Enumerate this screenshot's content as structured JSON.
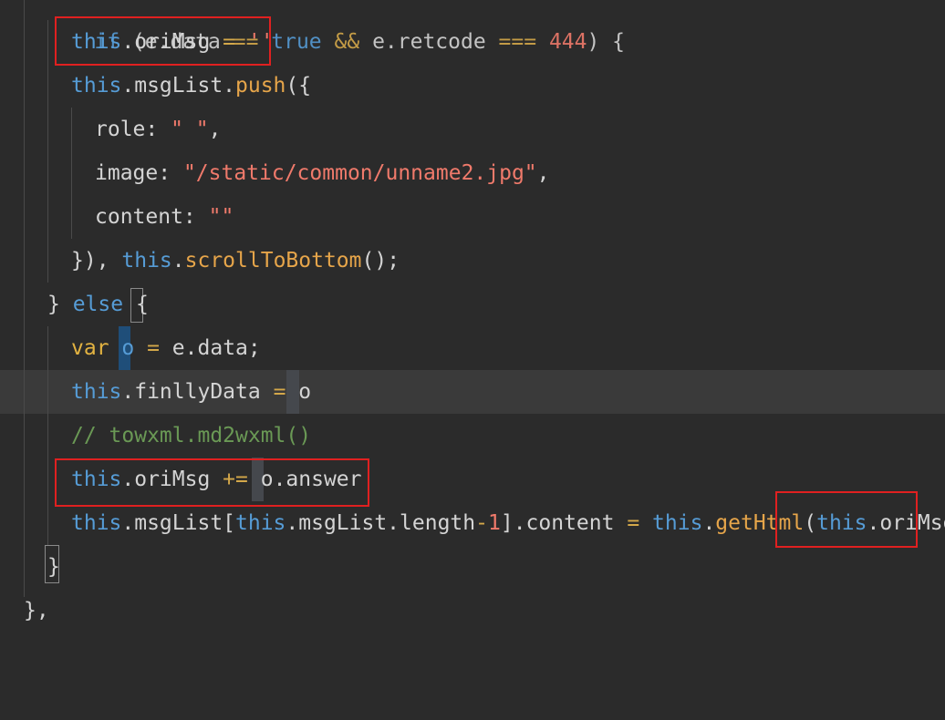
{
  "editor": {
    "top_partial": {
      "kw_if": "if",
      "rest": " (e.data ",
      "op1": "==",
      "kw_true": " true ",
      "op2": "&&",
      "rest2": " e.retcode ",
      "op3": "===",
      "num": " 444",
      "tail": ") {"
    },
    "lines": [
      {
        "kw": "this",
        "rest": ".oriMsg ",
        "op": "=",
        "str": " ''"
      },
      {
        "kw": "this",
        "prop": ".msgList.",
        "fn": "push",
        "tail": "({"
      },
      {
        "key": "role: ",
        "str": "\" \"",
        "tail": ","
      },
      {
        "key": "image: ",
        "str": "\"/static/common/unname2.jpg\"",
        "tail": ","
      },
      {
        "key": "content: ",
        "str": "\"\""
      },
      {
        "pre": "}), ",
        "kw": "this",
        "dot": ".",
        "fn": "scrollToBottom",
        "tail": "();"
      },
      {
        "pre": "} ",
        "kw": "else",
        "tail": " {"
      },
      {
        "kw": "var",
        "id": " o ",
        "op": "=",
        "tail": " e.data;"
      },
      {
        "kw": "this",
        "rest": ".finllyData ",
        "op": "=",
        "tail": " o"
      },
      {
        "cmt": "// towxml.md2wxml()"
      },
      {
        "kw": "this",
        "rest": ".oriMsg ",
        "op": "+=",
        "tail": " o.answer"
      },
      {
        "kw": "this",
        "rest1": ".msgList[",
        "kw2": "this",
        "rest2": ".msgList.length",
        "op": "-",
        "num": "1",
        "rest3": "].content ",
        "op2": "=",
        "kw3": " this",
        "dot": ".",
        "fn": "getHtml",
        "p1": "(",
        "kw4": "this",
        "rest4": ".oriMsg",
        "p2": ")"
      },
      {
        "tail": "}"
      },
      {
        "tail": "},"
      }
    ]
  },
  "colors": {
    "background": "#2b2b2b",
    "keyword": "#569cd6",
    "string": "#f07a6b",
    "function": "#e6a54a",
    "comment": "#6a9955",
    "highlight_box": "#e02020"
  }
}
